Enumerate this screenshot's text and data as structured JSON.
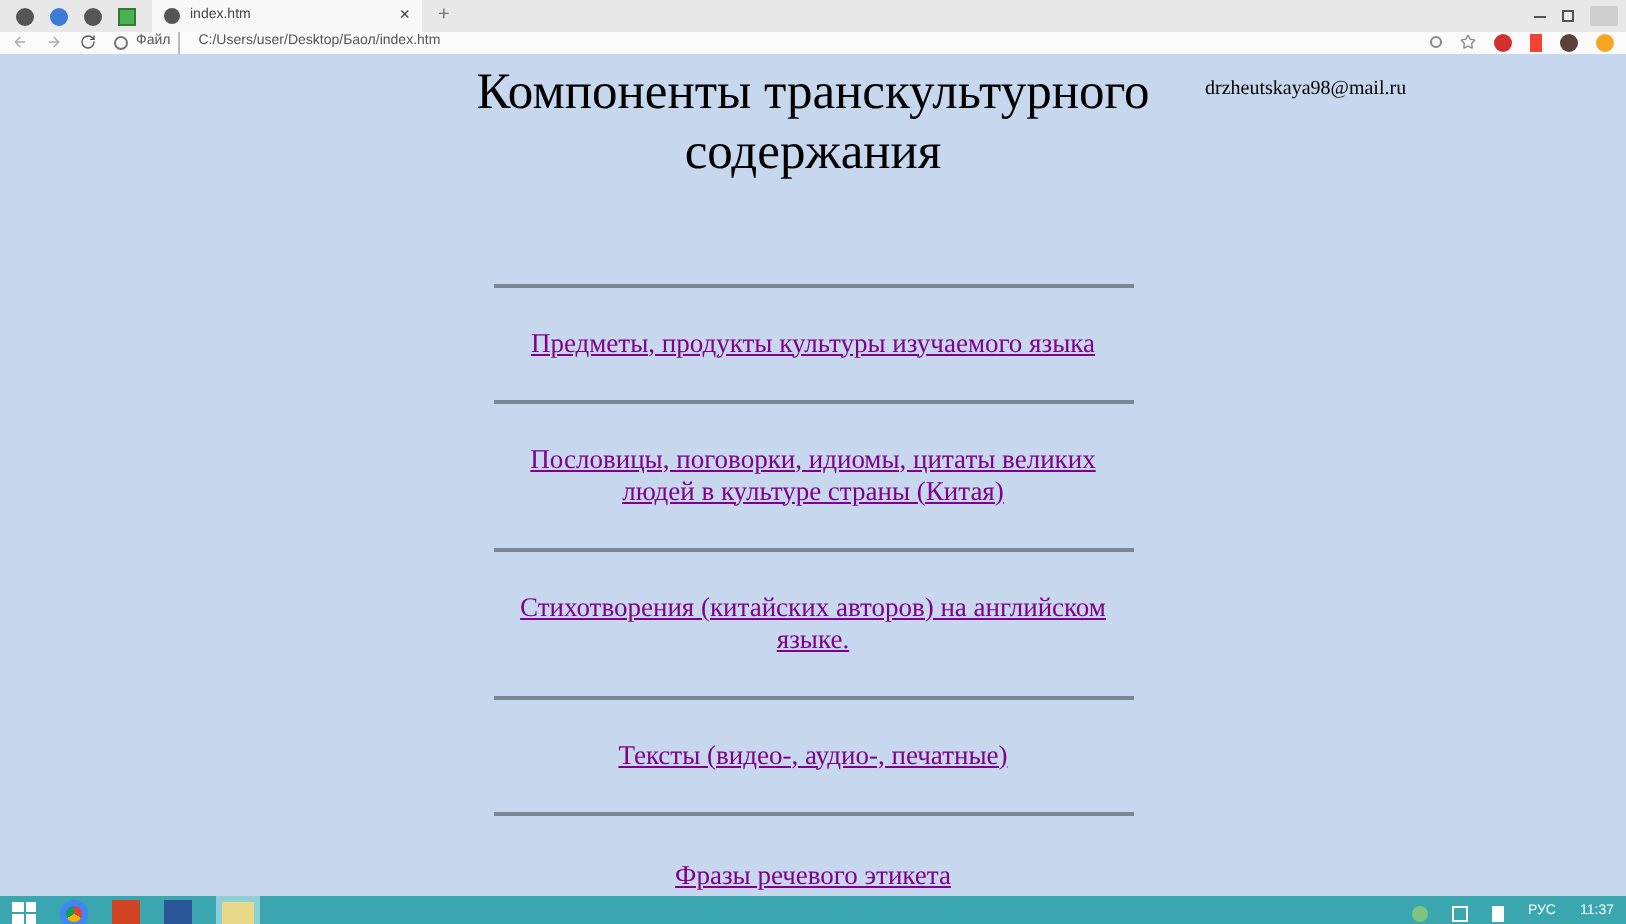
{
  "browser": {
    "tab": {
      "title": "index.htm",
      "close": "×",
      "new_tab": "+"
    },
    "address": {
      "scheme_label": "Файл",
      "url": "C:/Users/user/Desktop/Баол/index.htm"
    }
  },
  "page": {
    "title": "Компоненты транскультурного содержания",
    "email": "drzheutskaya98@mail.ru",
    "links": [
      {
        "text": "Предметы, продукты культуры изучаемого языка"
      },
      {
        "text": "Пословицы, поговорки, идиомы, цитаты великих людей в культуре страны (Китая)"
      },
      {
        "text": "Стихотворения (китайских авторов) на английском языке."
      },
      {
        "text": "Тексты (видео-, аудио-, печатные)"
      },
      {
        "text": "Фразы речевого этикета"
      }
    ]
  },
  "taskbar": {
    "language": "РУС",
    "time": "11:37"
  }
}
